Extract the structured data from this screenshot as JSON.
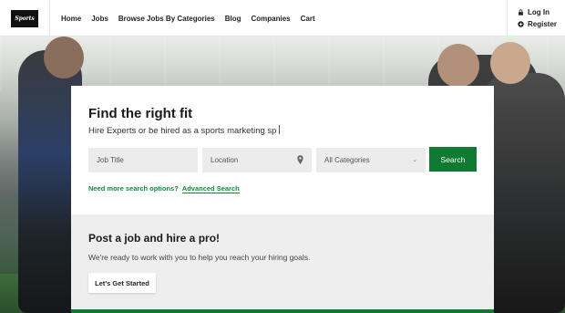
{
  "brand": {
    "logo_text": "Sports"
  },
  "nav": {
    "items": [
      {
        "label": "Home"
      },
      {
        "label": "Jobs"
      },
      {
        "label": "Browse Jobs By Categories"
      },
      {
        "label": "Blog"
      },
      {
        "label": "Companies"
      },
      {
        "label": "Cart"
      }
    ]
  },
  "account": {
    "login": {
      "label": "Log In",
      "icon": "lock-icon"
    },
    "register": {
      "label": "Register",
      "icon": "plus-circle-icon"
    }
  },
  "search_card": {
    "title": "Find the right fit",
    "subtitle": "Hire Experts or be hired as a sports marketing sp",
    "job_title_placeholder": "Job Title",
    "location_placeholder": "Location",
    "category_selected": "All Categories",
    "search_button": "Search",
    "more_options_text": "Need more search options?",
    "advanced_link": "Advanced Search"
  },
  "post_job": {
    "title": "Post a job and hire a pro!",
    "text": "We're ready to work with you to help you reach your hiring goals.",
    "button": "Let's Get Started"
  },
  "colors": {
    "accent": "#0f7a32",
    "link": "#128a3a",
    "field_bg": "#ececec",
    "panel_bg": "#eeeeee"
  }
}
